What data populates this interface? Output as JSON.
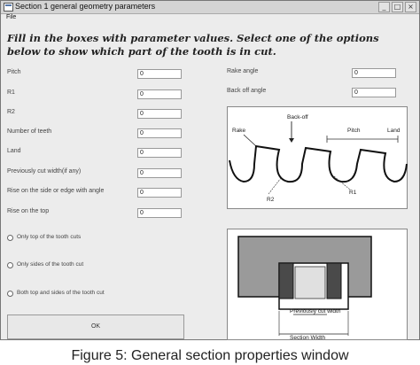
{
  "window": {
    "title": "Section 1 general geometry parameters",
    "menu": {
      "file": "File"
    }
  },
  "instruction": "Fill in the boxes with parameter values. Select one of the options below to show which part of the tooth is in cut.",
  "left_fields": [
    {
      "label": "Pitch",
      "value": "0"
    },
    {
      "label": "R1",
      "value": "0"
    },
    {
      "label": "R2",
      "value": "0"
    },
    {
      "label": "Number of teeth",
      "value": "0"
    },
    {
      "label": "Land",
      "value": "0"
    },
    {
      "label": "Previously cut width(if any)",
      "value": "0"
    },
    {
      "label": "Rise on the side or edge with angle",
      "value": "0"
    },
    {
      "label": "Rise on the top",
      "value": "0"
    }
  ],
  "right_fields": [
    {
      "label": "Rake angle",
      "value": "0"
    },
    {
      "label": "Back off angle",
      "value": "0"
    }
  ],
  "options": [
    {
      "label": "Only top of the tooth cuts"
    },
    {
      "label": "Only sides of the tooth cut"
    },
    {
      "label": "Both top and sides of the tooth cut"
    }
  ],
  "ok_label": "OK",
  "diagram_top": {
    "labels": {
      "back_off": "Back-off",
      "rake": "Rake",
      "pitch": "Pitch",
      "land": "Land",
      "r1": "R1",
      "r2": "R2"
    }
  },
  "diagram_bottom": {
    "labels": {
      "previously_cut_width": "Previously cut width",
      "section_width": "Section Width"
    }
  },
  "caption": "Figure 5: General section properties window"
}
